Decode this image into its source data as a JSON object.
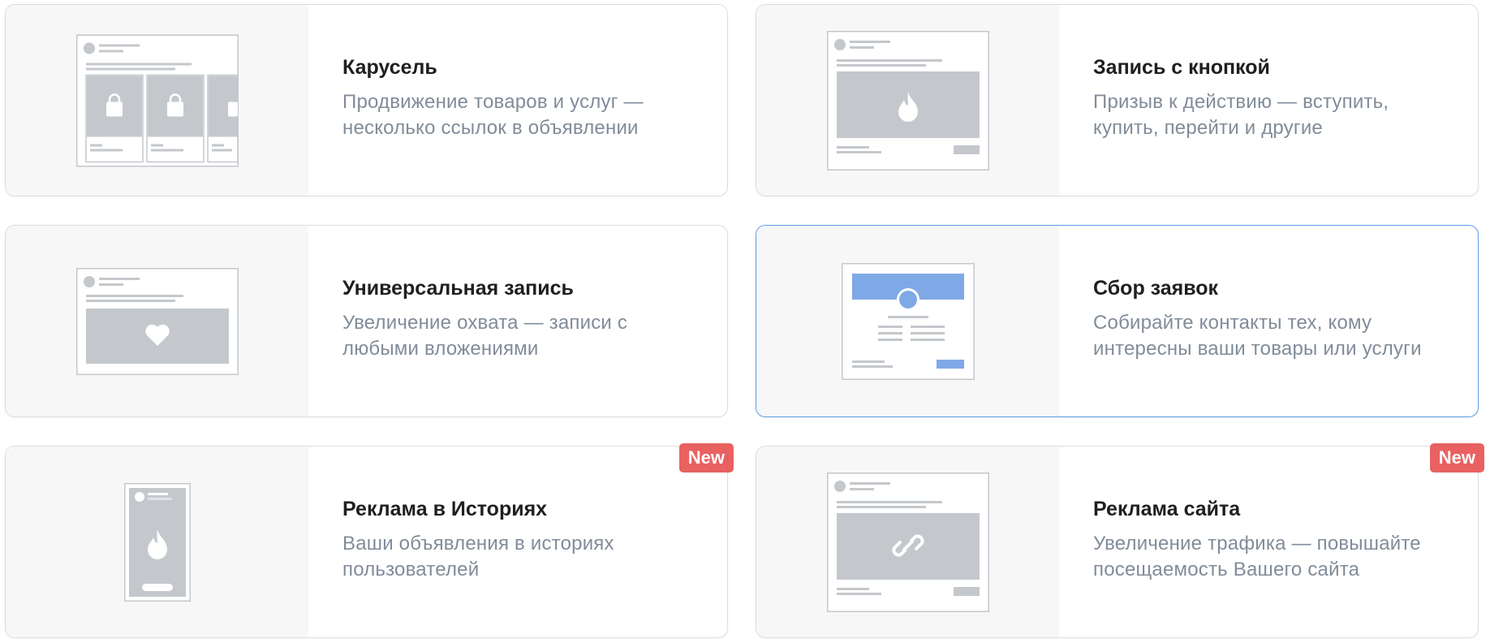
{
  "cards": [
    {
      "title": "Карусель",
      "description": "Продвижение товаров и услуг — несколько ссылок в объявлении",
      "icon": "carousel-preview-icon",
      "badge": ""
    },
    {
      "title": "Запись с кнопкой",
      "description": "Призыв к действию — вступить, купить, перейти и другие",
      "icon": "post-with-button-preview-icon",
      "badge": ""
    },
    {
      "title": "Универсальная запись",
      "description": "Увеличение охвата — записи с любыми вложениями",
      "icon": "universal-post-preview-icon",
      "badge": ""
    },
    {
      "title": "Сбор заявок",
      "description": "Собирайте контакты тех, кому интересны ваши товары или услуги",
      "icon": "lead-form-preview-icon",
      "badge": "",
      "selected": true
    },
    {
      "title": "Реклама в Историях",
      "description": "Ваши объявления в историях пользователей",
      "icon": "stories-preview-icon",
      "badge": "New"
    },
    {
      "title": "Реклама сайта",
      "description": "Увеличение трафика — повышайте посещаемость Вашего сайта",
      "icon": "website-ad-preview-icon",
      "badge": "New"
    }
  ],
  "colors": {
    "card_border": "#dcdde0",
    "selected_border": "#5c9ce6",
    "preview_bg": "#f7f7f8",
    "placeholder_gray": "#c4c8cc",
    "accent_blue": "#7fa9e6",
    "badge_red": "#e64646",
    "title_text": "#1f1f1f",
    "desc_text": "#818c99"
  }
}
